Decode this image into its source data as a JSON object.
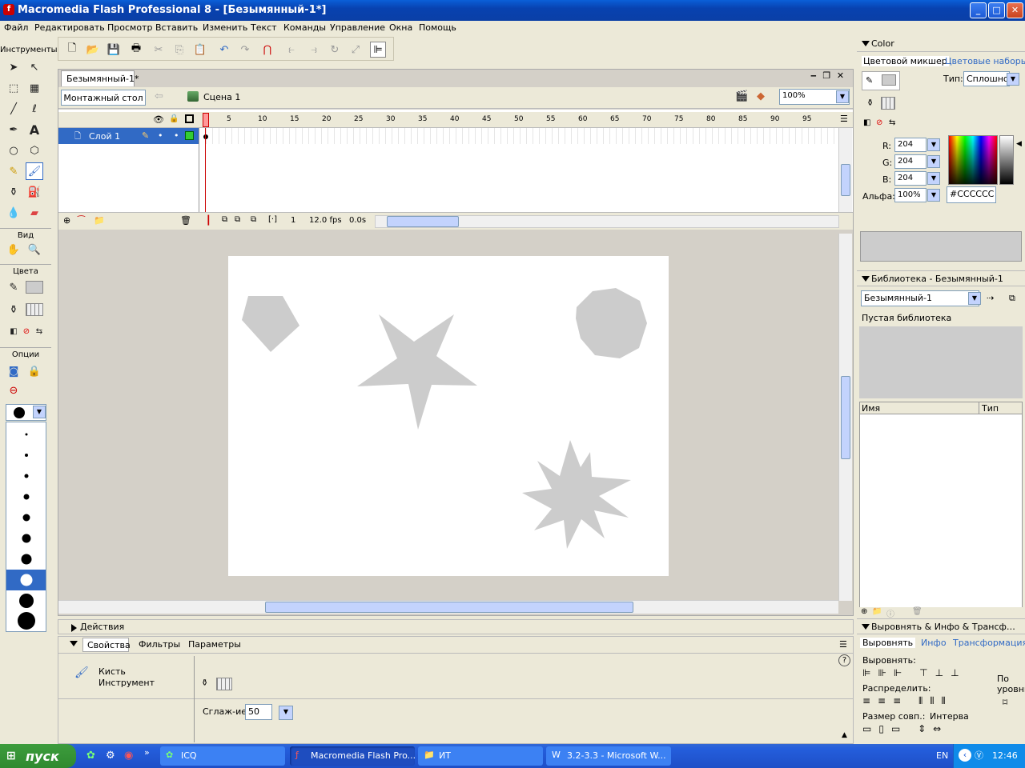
{
  "window": {
    "title": "Macromedia Flash Professional 8 - [Безымянный-1*]",
    "minimize": "_",
    "maximize": "□",
    "close": "✕"
  },
  "menu": [
    "Файл",
    "Редактировать",
    "Просмотр",
    "Вставить",
    "Изменить",
    "Текст",
    "Команды",
    "Управление",
    "Окна",
    "Помощь"
  ],
  "tools": {
    "title": "Инструменты",
    "view": "Вид",
    "colors": "Цвета",
    "options": "Опции"
  },
  "document": {
    "tab": "Безымянный-1*",
    "timeline_button": "Монтажный стол",
    "scene": "Сцена 1",
    "zoom": "100%",
    "frame_numbers": [
      "1",
      "5",
      "10",
      "15",
      "20",
      "25",
      "30",
      "35",
      "40",
      "45",
      "50",
      "55",
      "60",
      "65",
      "70",
      "75",
      "80",
      "85",
      "90",
      "95"
    ],
    "layer": "Слой 1",
    "current_frame": "1",
    "fps": "12.0 fps",
    "time": "0.0s"
  },
  "stage": {
    "background": "#FFFFFF",
    "shape_color": "#CCCCCC"
  },
  "panels": {
    "actions": "Действия",
    "properties_tabs": [
      "Свойства",
      "Фильтры",
      "Параметры"
    ],
    "tool_name": "Кисть",
    "tool_type": "Инструмент",
    "smoothing_label": "Сглаж-ие",
    "smoothing_value": "50",
    "help": "?"
  },
  "color_panel": {
    "title": "Color",
    "tabs": [
      "Цветовой микшер",
      "Цветовые наборы"
    ],
    "type_label": "Тип:",
    "type_value": "Сплошноі",
    "r_label": "R:",
    "r": "204",
    "g_label": "G:",
    "g": "204",
    "b_label": "B:",
    "b": "204",
    "alpha_label": "Альфа:",
    "alpha": "100%",
    "hex": "#CCCCCC"
  },
  "library_panel": {
    "title": "Библиотека - Безымянный-1",
    "select": "Безымянный-1",
    "empty": "Пустая библиотека",
    "col_name": "Имя",
    "col_type": "Тип"
  },
  "align_panel": {
    "title": "Выровнять & Инфо & Трансф…",
    "tabs": [
      "Выровнять",
      "Инфо",
      "Трансформация"
    ],
    "align": "Выровнять:",
    "distribute": "Распределить:",
    "match_size": "Размер совп.:",
    "spacing": "Интерва",
    "to_stage": "По уровню"
  },
  "taskbar": {
    "start": "пуск",
    "tasks": [
      "ICQ",
      "Macromedia Flash Pro...",
      "ИТ",
      "3.2-3.3 - Microsoft W..."
    ],
    "lang": "EN",
    "clock": "12:46"
  }
}
